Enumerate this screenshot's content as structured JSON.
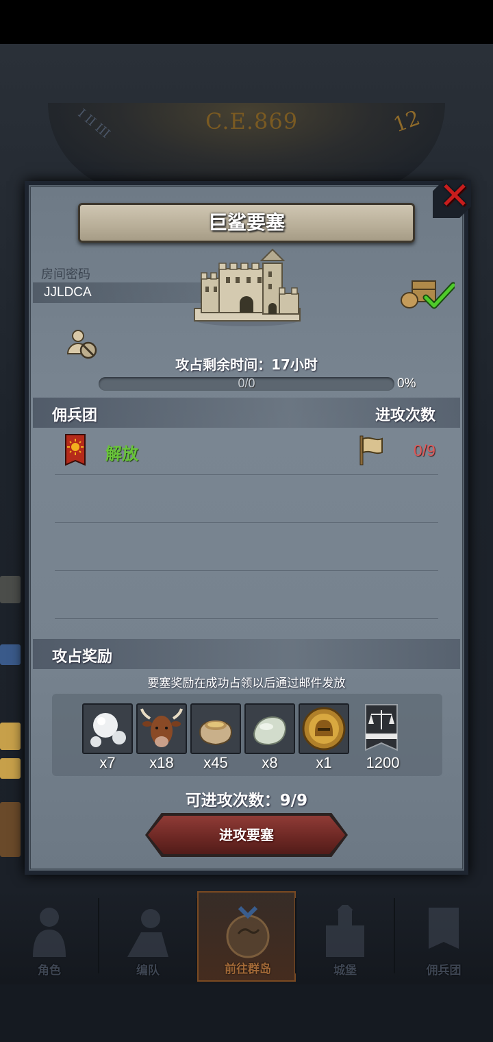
{
  "background": {
    "clock_year": "C.E.869",
    "clock_hour": "12"
  },
  "panel": {
    "title": "巨鲨要塞",
    "close_icon": "close-icon",
    "room_label": "房间密码",
    "room_code": "JJLDCA",
    "time_text": "攻占剩余时间：17小时",
    "progress": {
      "label": "0/0",
      "percent_text": "0%",
      "fraction": 0
    }
  },
  "mercenaries": {
    "col_left": "佣兵团",
    "col_right": "进攻次数",
    "rows": [
      {
        "name": "解放",
        "count": "0/9"
      }
    ]
  },
  "rewards": {
    "title": "攻占奖励",
    "note": "要塞奖励在成功占领以后通过邮件发放",
    "items": [
      {
        "icon": "pearl-icon",
        "qty": "x7"
      },
      {
        "icon": "cow-icon",
        "qty": "x18"
      },
      {
        "icon": "grain-sack-icon",
        "qty": "x45"
      },
      {
        "icon": "stone-icon",
        "qty": "x8"
      },
      {
        "icon": "gold-helmet-coin-icon",
        "qty": "x1"
      },
      {
        "icon": "justice-banner-icon",
        "qty": "1200"
      }
    ]
  },
  "attempts_text": "可进攻次数：9/9",
  "attack_button": "进攻要塞",
  "bottom_nav": [
    {
      "label": "角色",
      "icon": "knight-icon"
    },
    {
      "label": "编队",
      "icon": "formation-icon"
    },
    {
      "label": "前往群岛",
      "icon": "island-icon"
    },
    {
      "label": "城堡",
      "icon": "castle-icon"
    },
    {
      "label": "佣兵团",
      "icon": "mercenary-icon"
    }
  ],
  "colors": {
    "accent_red": "#c81d1d",
    "liberation_green": "#69c43a",
    "count_red": "#e05a5a",
    "button_red": "#6b2723"
  }
}
